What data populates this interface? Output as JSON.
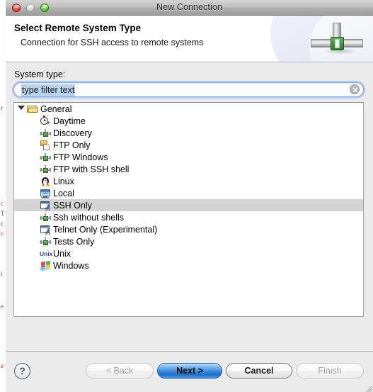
{
  "window": {
    "title": "New Connection",
    "controls": {
      "close": "close-button",
      "minimize": "minimize-button",
      "zoom": "zoom-button"
    }
  },
  "header": {
    "title": "Select Remote System Type",
    "subtitle": "Connection for SSH access to remote systems",
    "icon": "network-connection-icon"
  },
  "form": {
    "system_type_label": "System type:",
    "filter": {
      "value": "type filter text",
      "placeholder": "type filter text",
      "selected": true,
      "clear_icon": "clear-circle-x-icon"
    }
  },
  "tree": {
    "root": {
      "label": "General",
      "icon": "folder-icon",
      "expanded": true,
      "twisty": "triangle-down-icon"
    },
    "items": [
      {
        "label": "Daytime",
        "icon": "clock-icon",
        "selected": false
      },
      {
        "label": "Discovery",
        "icon": "node-icon",
        "selected": false
      },
      {
        "label": "FTP Only",
        "icon": "ftp-folder-icon",
        "selected": false
      },
      {
        "label": "FTP Windows",
        "icon": "node-icon",
        "selected": false
      },
      {
        "label": "FTP with SSH shell",
        "icon": "node-icon",
        "selected": false
      },
      {
        "label": "Linux",
        "icon": "linux-penguin-icon",
        "selected": false
      },
      {
        "label": "Local",
        "icon": "monitor-icon",
        "selected": false
      },
      {
        "label": "SSH Only",
        "icon": "terminal-window-icon",
        "selected": true
      },
      {
        "label": "Ssh without shells",
        "icon": "node-icon",
        "selected": false
      },
      {
        "label": "Telnet Only (Experimental)",
        "icon": "terminal-window-icon",
        "selected": false
      },
      {
        "label": "Tests Only",
        "icon": "node-icon",
        "selected": false
      },
      {
        "label": "Unix",
        "icon": "unix-text-icon",
        "selected": false
      },
      {
        "label": "Windows",
        "icon": "windows-flag-icon",
        "selected": false
      }
    ]
  },
  "footer": {
    "help_label": "?",
    "back_label": "< Back",
    "next_label": "Next >",
    "cancel_label": "Cancel",
    "finish_label": "Finish",
    "back_enabled": false,
    "next_enabled": true,
    "cancel_enabled": true,
    "finish_enabled": false
  },
  "colors": {
    "accent": "#3d8ee0",
    "selection": "#d3d3d3",
    "field_focus": "#6ea0e1",
    "text_selection": "#b7d2ee"
  }
}
